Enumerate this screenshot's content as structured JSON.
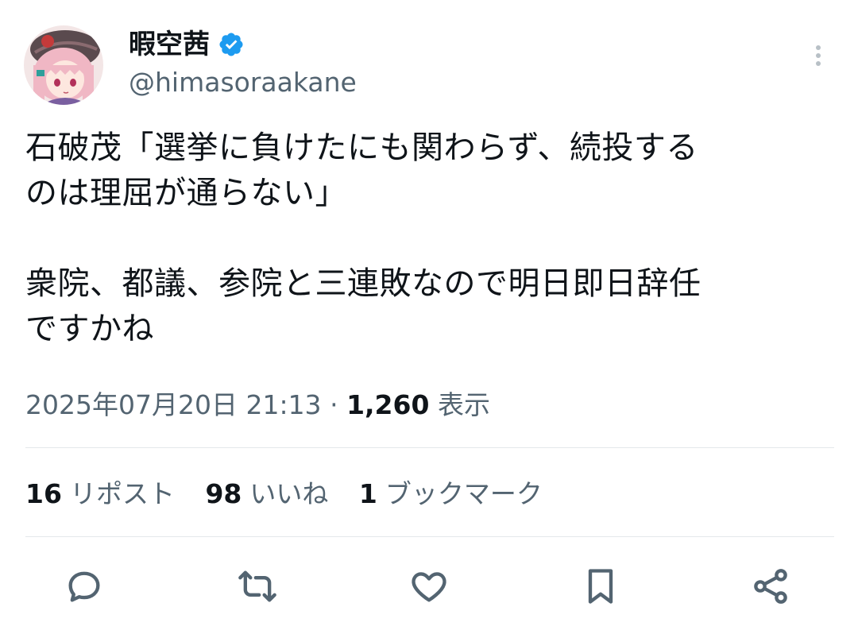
{
  "tweet": {
    "display_name": "暇空茜",
    "verified": true,
    "handle": "@himasoraakane",
    "text": "石破茂「選挙に負けたにも関わらず、続投する\nのは理屈が通らない」\n\n衆院、都議、参院と三連敗なので明日即日辞任\nですかね",
    "timestamp": "2025年07月20日 21:13",
    "separator": "·",
    "views_count": "1,260",
    "views_label": "表示"
  },
  "stats": {
    "reposts_count": "16",
    "reposts_label": "リポスト",
    "likes_count": "98",
    "likes_label": "いいね",
    "bookmarks_count": "1",
    "bookmarks_label": "ブックマーク"
  },
  "icons": {
    "verified": "verified-badge-icon",
    "more": "more-vertical-icon",
    "reply": "reply-icon",
    "repost": "repost-icon",
    "like": "heart-icon",
    "bookmark": "bookmark-icon",
    "share": "share-icon"
  },
  "colors": {
    "verified_blue": "#1d9bf0",
    "secondary_text": "#536471",
    "primary_text": "#0f1419",
    "divider": "#e4e8eb"
  }
}
